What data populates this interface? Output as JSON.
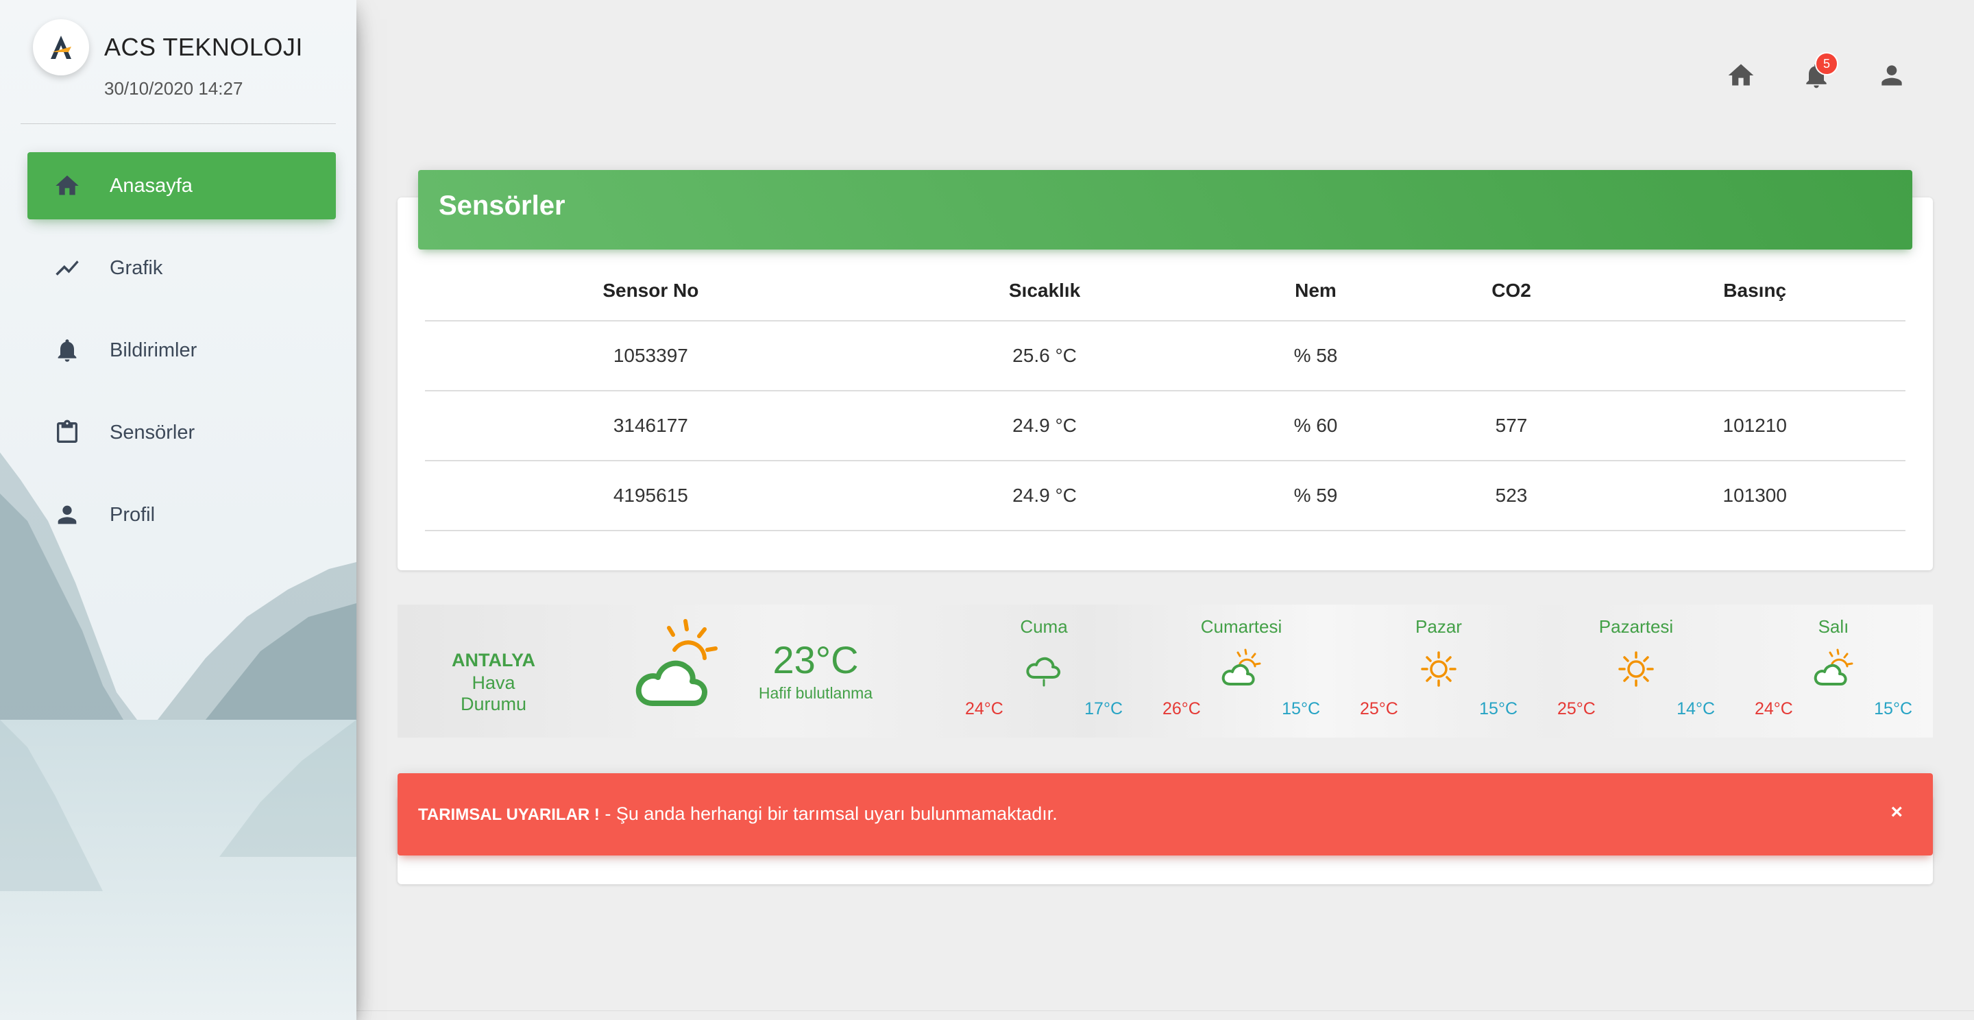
{
  "brand": {
    "name": "ACS TEKNOLOJI",
    "datetime": "30/10/2020 14:27"
  },
  "sidebar": {
    "items": [
      {
        "label": "Anasayfa",
        "icon": "home-icon",
        "active": true
      },
      {
        "label": "Grafik",
        "icon": "trend-icon",
        "active": false
      },
      {
        "label": "Bildirimler",
        "icon": "bell-icon",
        "active": false
      },
      {
        "label": "Sensörler",
        "icon": "clipboard-icon",
        "active": false
      },
      {
        "label": "Profil",
        "icon": "person-icon",
        "active": false
      }
    ]
  },
  "topbar": {
    "notification_count": "5"
  },
  "sensors": {
    "title": "Sensörler",
    "columns": [
      "Sensor No",
      "Sıcaklık",
      "Nem",
      "CO2",
      "Basınç"
    ],
    "rows": [
      [
        "1053397",
        "25.6 °C",
        "% 58",
        "",
        ""
      ],
      [
        "3146177",
        "24.9 °C",
        "% 60",
        "577",
        "101210"
      ],
      [
        "4195615",
        "24.9 °C",
        "% 59",
        "523",
        "101300"
      ]
    ]
  },
  "weather": {
    "city": "ANTALYA",
    "subtitle": "Hava Durumu",
    "current_temp": "23°C",
    "description": "Hafif bulutlanma",
    "current_icon": "partly-cloudy-icon",
    "days": [
      {
        "name": "Cuma",
        "icon": "rain-cloud-icon",
        "high": "24°C",
        "low": "17°C"
      },
      {
        "name": "Cumartesi",
        "icon": "partly-cloudy-icon",
        "high": "26°C",
        "low": "15°C"
      },
      {
        "name": "Pazar",
        "icon": "sun-icon",
        "high": "25°C",
        "low": "15°C"
      },
      {
        "name": "Pazartesi",
        "icon": "sun-icon",
        "high": "25°C",
        "low": "14°C"
      },
      {
        "name": "Salı",
        "icon": "partly-cloudy-icon",
        "high": "24°C",
        "low": "15°C"
      }
    ]
  },
  "alert": {
    "title": "TARIMSAL UYARILAR !",
    "separator": " - ",
    "message": "Şu anda herhangi bir tarımsal uyarı bulunmamaktadır.",
    "close": "×"
  },
  "colors": {
    "green": "#4caf50",
    "red": "#f55a4e",
    "orange": "#f39200",
    "text": "#3c4858"
  }
}
